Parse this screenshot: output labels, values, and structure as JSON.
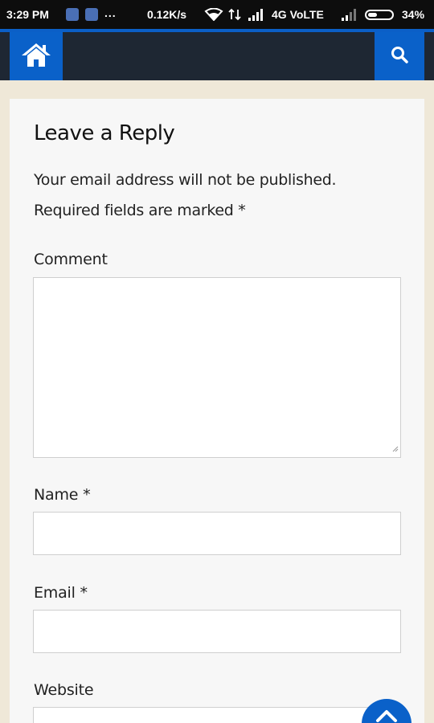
{
  "status_bar": {
    "time": "3:29 PM",
    "dots": "...",
    "speed": "0.12K/s",
    "network": "4G VoLTE",
    "battery": "34%"
  },
  "nav": {
    "home_icon": "home-icon",
    "search_icon": "search-icon",
    "accent_color": "#0a61c9",
    "bar_color": "#1e2733"
  },
  "form": {
    "title": "Leave a Reply",
    "note_line1": "Your email address will not be published.",
    "note_line2": "Required fields are marked *",
    "comment_label": "Comment",
    "comment_value": "",
    "name_label": "Name *",
    "name_value": "",
    "email_label": "Email *",
    "email_value": "",
    "website_label": "Website",
    "website_value": ""
  },
  "back_to_top_icon": "chevron-up-icon"
}
